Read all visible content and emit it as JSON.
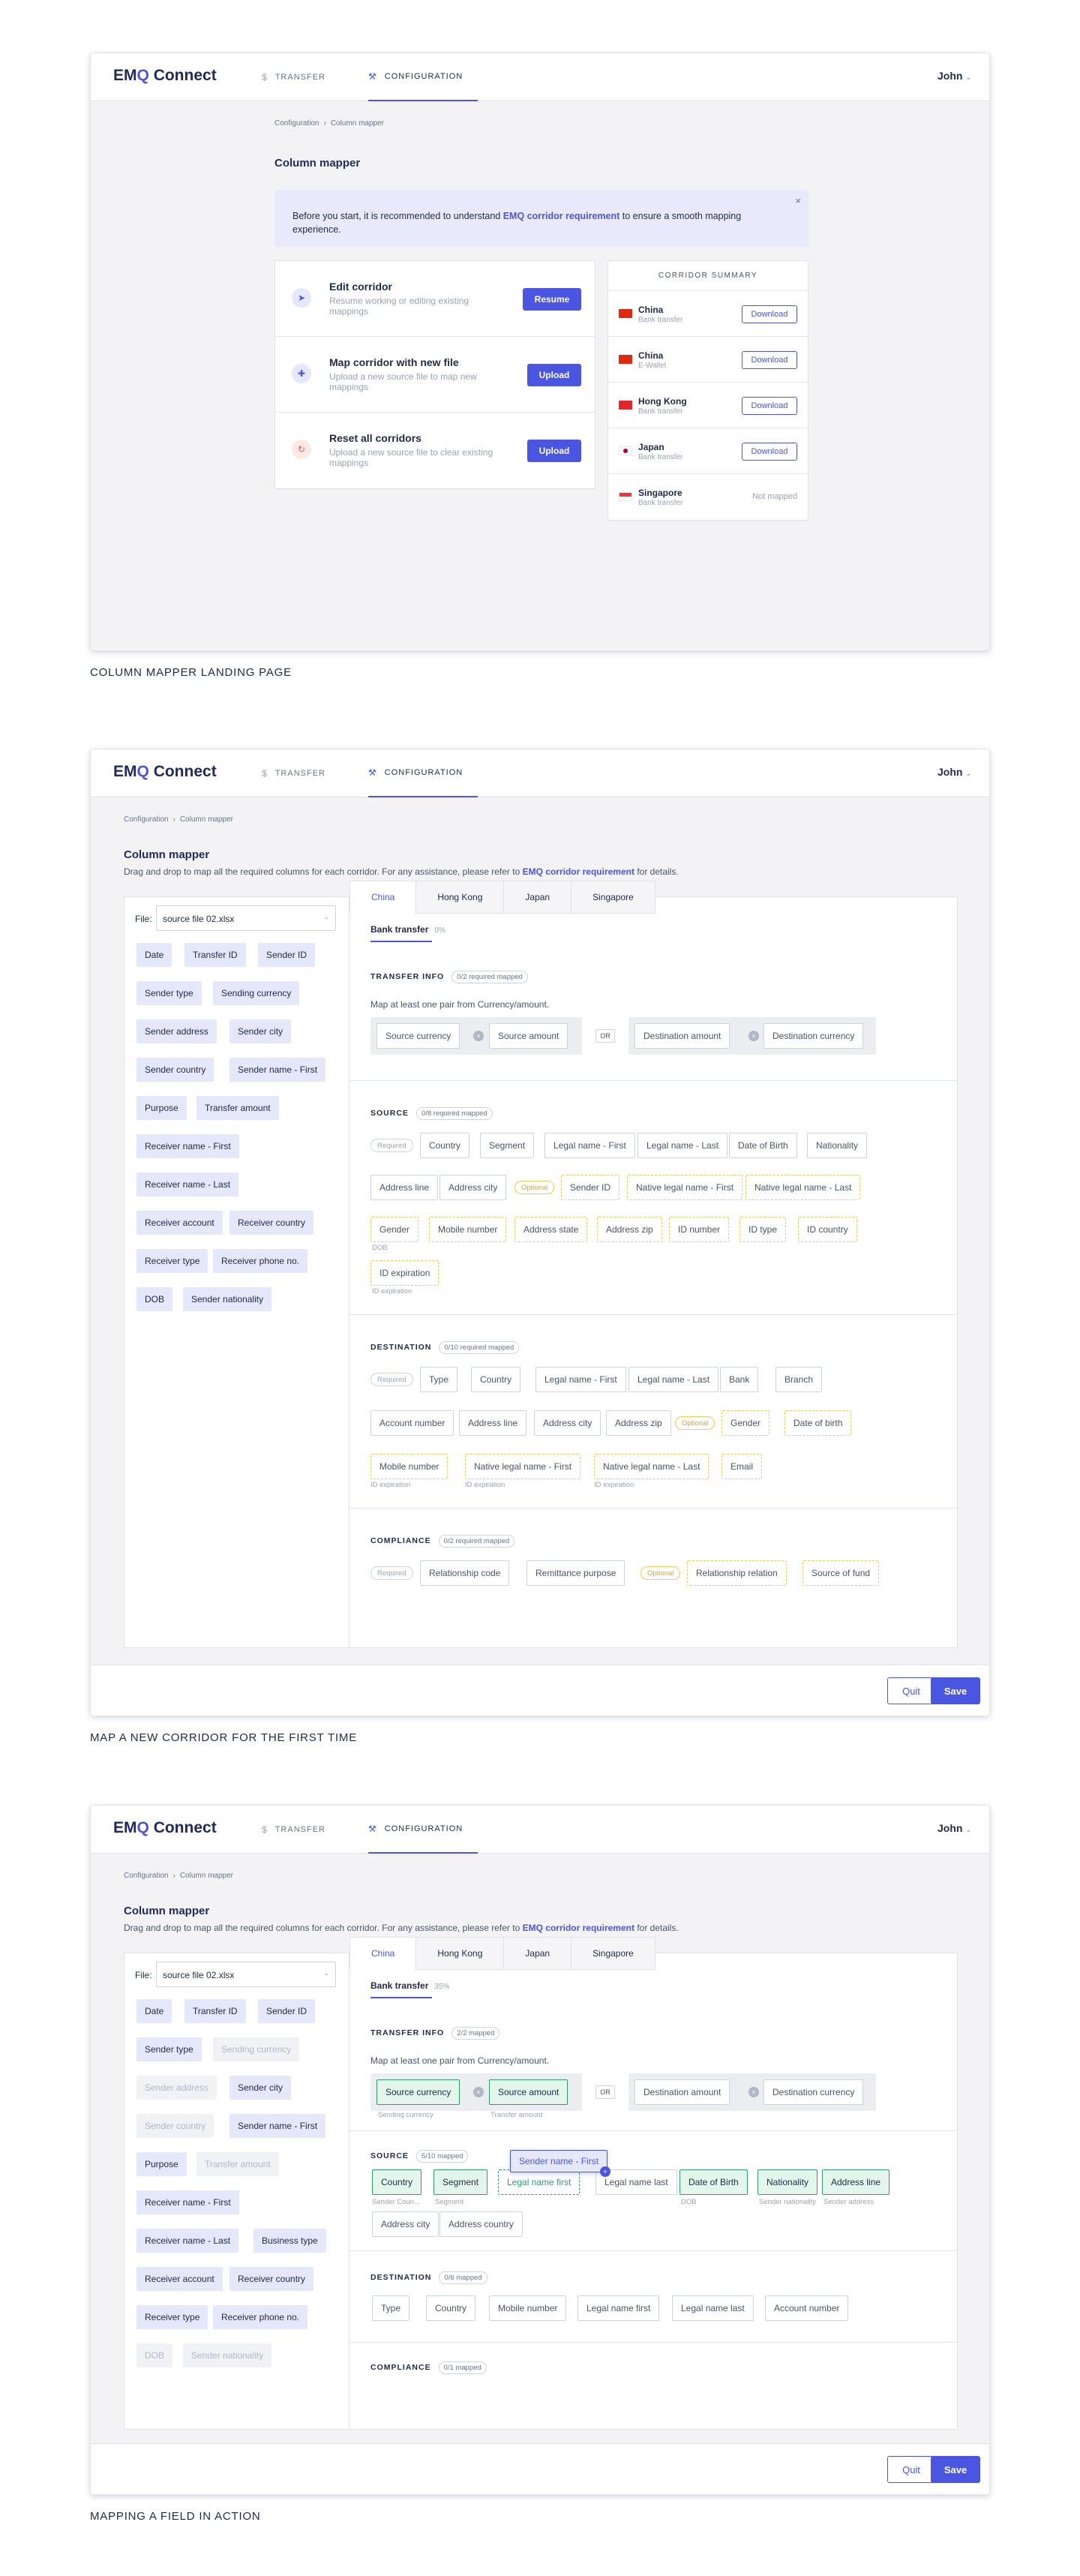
{
  "header": {
    "logo_emq_e": "EM",
    "logo_emq_q": "Q",
    "logo_connect": "Connect",
    "nav_transfer": "TRANSFER",
    "nav_configuration": "CONFIGURATION",
    "user": "John"
  },
  "icons": {
    "transfer": "dollar-icon",
    "configuration": "wrench-icon",
    "chevron": "chevron-down-icon"
  },
  "colors": {
    "accent": "#4a56e2",
    "mapped": "#2f9e6d",
    "optional": "#f0c95c"
  },
  "breadcrumb": {
    "root": "Configuration",
    "current": "Column mapper"
  },
  "landing": {
    "title": "Column mapper",
    "banner_pre": "Before you start, it is recommended to understand ",
    "banner_link": "EMQ corridor requirement",
    "banner_post": " to ensure a smooth mapping experience.",
    "actions": [
      {
        "title": "Edit corridor",
        "desc": "Resume working or editing existing mappings",
        "button": "Resume"
      },
      {
        "title": "Map corridor with new file",
        "desc": "Upload a new source file to map new mappings",
        "button": "Upload"
      },
      {
        "title": "Reset all corridors",
        "desc": "Upload a new source file to clear existing mappings",
        "button": "Upload"
      }
    ],
    "summary_title": "CORRIDOR SUMMARY",
    "summary": [
      {
        "name": "China",
        "type": "Bank transfer",
        "action": "Download"
      },
      {
        "name": "China",
        "type": "E-Wallet",
        "action": "Download"
      },
      {
        "name": "Hong Kong",
        "type": "Bank transfer",
        "action": "Download"
      },
      {
        "name": "Japan",
        "type": "Bank transfer",
        "action": "Download"
      },
      {
        "name": "Singapore",
        "type": "Bank transfer",
        "action": "Not mapped"
      }
    ],
    "caption": "COLUMN MAPPER LANDING PAGE"
  },
  "mapper": {
    "title": "Column mapper",
    "desc_pre": "Drag and drop to map all the required columns for each corridor. For any assistance, please refer to ",
    "desc_link": "EMQ corridor requirement",
    "desc_post": " for details.",
    "file_label": "File:",
    "file_value": "source file 02.xlsx",
    "tabs": [
      "China",
      "Hong Kong",
      "Japan",
      "Singapore"
    ],
    "subtab": "Bank transfer",
    "quit": "Quit",
    "save": "Save",
    "pill_required": "Required",
    "pill_optional": "Optional",
    "or": "OR",
    "note": "Map at least one pair from Currency/amount.",
    "sections": {
      "transfer": "TRANSFER INFO",
      "source": "SOURCE",
      "destination": "DESTINATION",
      "compliance": "COMPLIANCE"
    },
    "fields": {
      "source_currency": "Source currency",
      "source_amount": "Source amount",
      "destination_amount": "Destination amount",
      "destination_currency": "Destination currency"
    }
  },
  "screen2": {
    "subtab_pct": "0%",
    "transfer_badge": "0/2 required mapped",
    "source_badge": "0/8 required mapped",
    "destination_badge": "0/10 required mapped",
    "compliance_badge": "0/2 required mapped",
    "columns": [
      "Date",
      "Transfer ID",
      "Sender ID",
      "Sender type",
      "Sending currency",
      "Sender address",
      "Sender city",
      "Sender country",
      "Sender name - First",
      "Purpose",
      "Transfer amount",
      "Receiver name - First",
      "Receiver name - Last",
      "Receiver account",
      "Receiver country",
      "Receiver type",
      "Receiver phone no.",
      "DOB",
      "Sender nationality"
    ],
    "source_required": [
      "Country",
      "Segment",
      "Legal name - First",
      "Legal name - Last",
      "Date of Birth",
      "Nationality",
      "Address line",
      "Address city"
    ],
    "source_optional": [
      "Sender ID",
      "Native legal name - First",
      "Native legal name - Last",
      "Gender",
      "Mobile number",
      "Address state",
      "Address zip",
      "ID number",
      "ID type",
      "ID country",
      "ID expiration"
    ],
    "source_subs": [
      "DOB",
      "ID expiration"
    ],
    "dest_required": [
      "Type",
      "Country",
      "Legal name - First",
      "Legal name - Last",
      "Bank",
      "Branch",
      "Account number",
      "Address line",
      "Address city",
      "Address zip"
    ],
    "dest_optional": [
      "Gender",
      "Date of birth",
      "Mobile number",
      "Native legal name - First",
      "Native legal name - Last",
      "Email"
    ],
    "dest_subs": [
      "ID expiration",
      "ID expiration",
      "ID expiration"
    ],
    "comp_required": [
      "Relationship code",
      "Remittance purpose"
    ],
    "comp_optional": [
      "Relationship relation",
      "Source of fund"
    ],
    "caption": "MAP A NEW CORRIDOR FOR THE FIRST TIME"
  },
  "screen3": {
    "subtab_pct": "35%",
    "transfer_badge": "2/2 mapped",
    "source_badge": "5/10 mapped",
    "destination_badge": "0/6 mapped",
    "compliance_badge": "0/1 mapped",
    "columns": [
      "Date",
      "Transfer ID",
      "Sender ID",
      "Sender type",
      "Sending currency",
      "Sender address",
      "Sender city",
      "Sender country",
      "Sender name - First",
      "Purpose",
      "Transfer amount",
      "Receiver name - First",
      "Receiver name - Last",
      "Business type",
      "Receiver account",
      "Receiver country",
      "Receiver type",
      "Receiver phone no.",
      "DOB",
      "Sender nationality"
    ],
    "transfer_subs": [
      "Sending currency",
      "Transfer amount"
    ],
    "source_fields": [
      "Country",
      "Segment",
      "Legal name first",
      "Legal name last",
      "Date of Birth",
      "Nationality",
      "Address line",
      "Address city",
      "Address country"
    ],
    "source_subs": [
      "Sender Coun...",
      "Segment",
      "DOB",
      "Sender nationality",
      "Sender address"
    ],
    "drag": "Sender name - First",
    "dest_fields": [
      "Type",
      "Country",
      "Mobile number",
      "Legal name first",
      "Legal name last",
      "Account number"
    ],
    "caption": "MAPPING A FIELD IN ACTION"
  }
}
